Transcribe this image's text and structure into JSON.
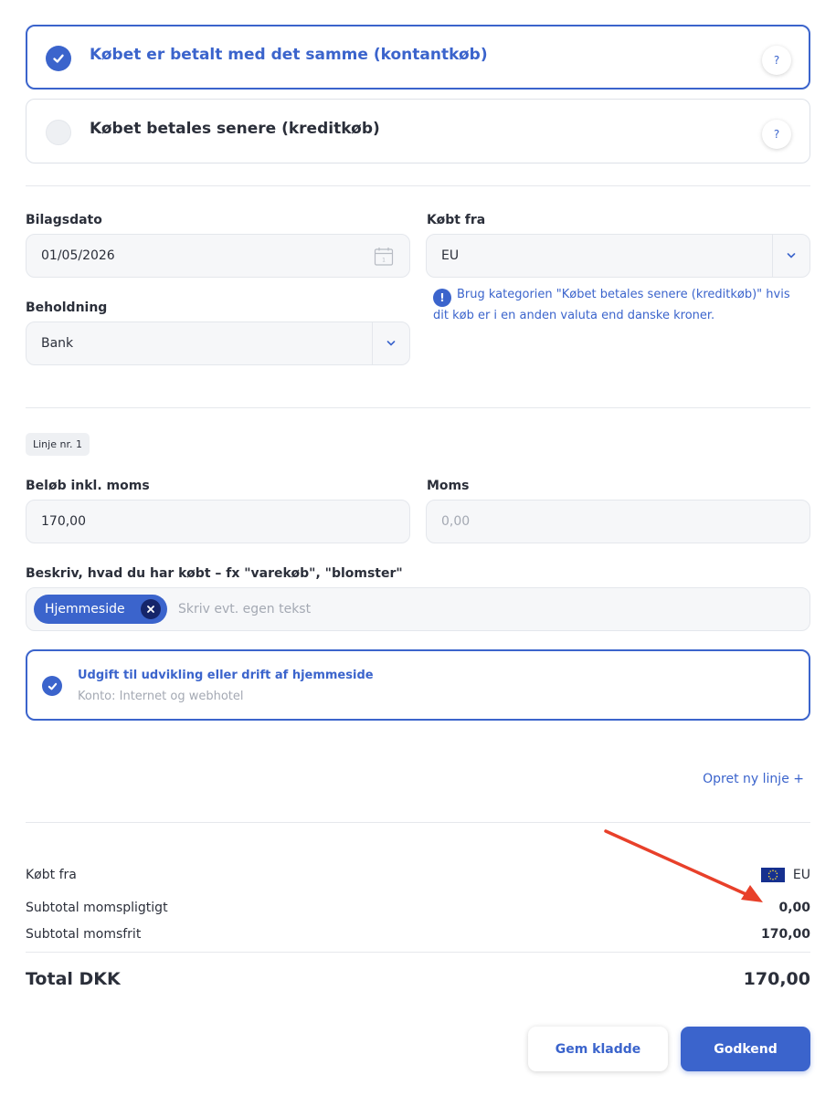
{
  "payment_options": [
    {
      "label": "Købet er betalt med det samme (kontantkøb)",
      "selected": true,
      "help": "?"
    },
    {
      "label": "Købet betales senere (kreditkøb)",
      "selected": false,
      "help": "?"
    }
  ],
  "bilagsdato": {
    "label": "Bilagsdato",
    "value": "01/05/2026",
    "icon": "calendar-icon"
  },
  "kobt_fra": {
    "label": "Købt fra",
    "value": "EU",
    "icon": "chevron-down-icon"
  },
  "info": {
    "icon": "!",
    "text": "Brug kategorien \"Købet betales senere (kreditkøb)\" hvis dit køb er i en anden valuta end danske kroner."
  },
  "beholdning": {
    "label": "Beholdning",
    "value": "Bank"
  },
  "line": {
    "badge": "Linje nr. 1",
    "amount_label": "Beløb inkl. moms",
    "amount_value": "170,00",
    "vat_label": "Moms",
    "vat_placeholder": "0,00",
    "description_label": "Beskriv, hvad du har købt – fx \"varekøb\", \"blomster\"",
    "chip": "Hjemmeside",
    "description_placeholder": "Skriv evt. egen tekst"
  },
  "account": {
    "title": "Udgift til udvikling eller drift af hjemmeside",
    "subtitle": "Konto: Internet og webhotel"
  },
  "new_line_link": "Opret ny linje +",
  "summary": {
    "kobt_fra_label": "Købt fra",
    "kobt_fra_value": "EU",
    "momspligtigt_label": "Subtotal momspligtigt",
    "momspligtigt_value": "0,00",
    "momsfrit_label": "Subtotal momsfrit",
    "momsfrit_value": "170,00",
    "total_label": "Total DKK",
    "total_value": "170,00"
  },
  "buttons": {
    "save_draft": "Gem kladde",
    "approve": "Godkend"
  },
  "colors": {
    "accent": "#3b64cc",
    "annotation_arrow": "#e8402a"
  }
}
